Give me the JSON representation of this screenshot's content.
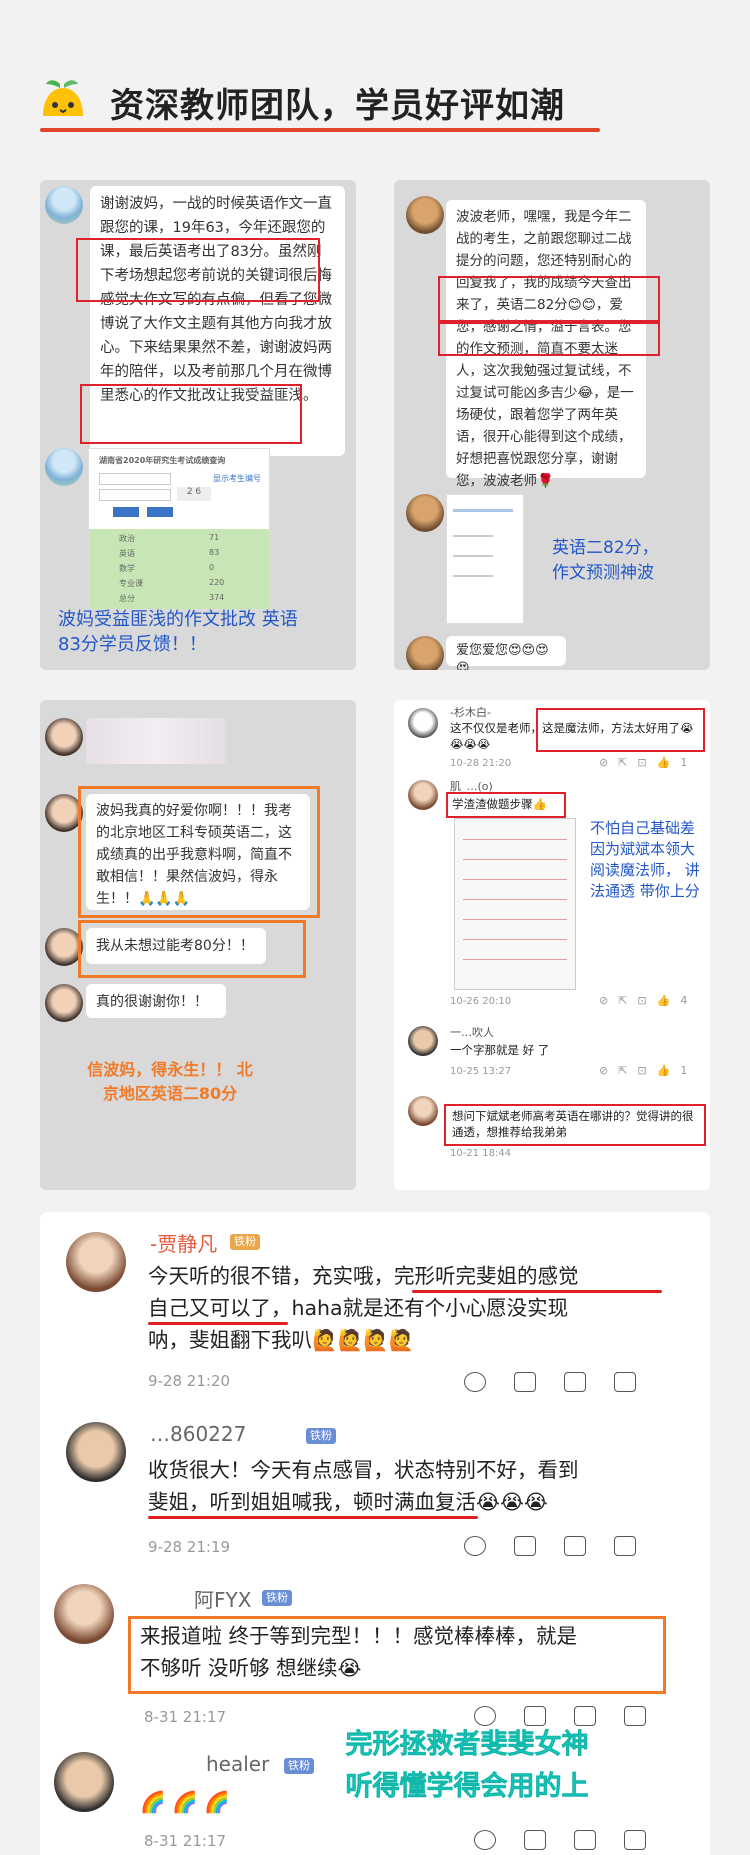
{
  "header": {
    "title": "资深教师团队，学员好评如潮",
    "logo_icon": "orange-mascot-icon",
    "accent": "#e0452a"
  },
  "panel1": {
    "message1": "谢谢波妈，一战的时候英语作文一直跟您的课，19年63，今年还跟您的课，最后英语考出了83分。虽然刚下考场想起您考前说的关键词很后悔感觉大作文写的有点偏，但看了您微博说了大作文主题有其他方向我才放心。下来结果果然不差，谢谢波妈两年的陪伴，以及考前那几个月在微博里悉心的作文批改让我受益匪浅。",
    "score_screenshot_title": "湖南省2020年研究生考试成绩查询",
    "score_link": "显示考生编号",
    "score_rows": [
      {
        "subject": "政治",
        "score": "71"
      },
      {
        "subject": "英语",
        "score": "83"
      },
      {
        "subject": "数学",
        "score": "0"
      },
      {
        "subject": "专业课",
        "score": "220"
      },
      {
        "subject": "总分",
        "score": "374"
      }
    ],
    "caption": "波妈受益匪浅的作文批改 英语83分学员反馈！！"
  },
  "panel2": {
    "message1": "波波老师，嘿嘿，我是今年二战的考生，之前跟您聊过二战提分的问题，您还特别耐心的回复我了，我的成绩今天查出来了，英语二82分😊😊，爱您，感谢之情，溢于言表。您的作文预测，简直不要太迷人，这次我勉强过复试线，不过复试可能凶多吉少😂，是一场硬仗，跟着您学了两年英语，很开心能得到这个成绩，好想把喜悦跟您分享，谢谢您，波波老师🌹",
    "message2": "爱您爱您😍😍😍😍",
    "caption": "英语二82分， 作文预测神波"
  },
  "panel3": {
    "message1": "波妈我真的好爱你啊！！！我考的北京地区工科专硕英语二，这成绩真的出乎我意料啊，简直不敢相信！！果然信波妈，得永生！！🙏🙏🙏",
    "message2": "我从未想过能考80分！！",
    "message3": "真的很谢谢你！！",
    "caption": "信波妈，得永生！！ 北京地区英语二80分"
  },
  "panel4": {
    "c1_name": "-杉木白-",
    "c1_text": "这不仅仅是老师，这是魔法师，方法太好用了😭😭😭😭",
    "c1_time": "10-28 21:20",
    "c1_likes": "1",
    "c2_name": "肌_…(o)",
    "c2_text": "学渣渣做题步骤👍",
    "c2_time": "10-26 20:10",
    "c2_likes": "4",
    "side_note": "不怕自己基础差 因为斌斌本领大 阅读魔法师， 讲法通透 带你上分",
    "c3_name": "一…吹人",
    "c3_text": "一个字那就是 好 了",
    "c3_time": "10-25 13:27",
    "c3_likes": "1",
    "c4_text": "想问下斌斌老师高考英语在哪讲的？觉得讲的很通透，想推荐给我弟弟",
    "c4_time": "10-21 18:44"
  },
  "comments": [
    {
      "name": "-贾静凡",
      "badge": "铁粉",
      "text1": "今天听的很不错，充实哦，完形听完斐姐的感觉",
      "text2": "自己又可以了，haha就是还有个小心愿没实现",
      "text3": "呐，斐姐翻下我叭🙋🙋🙋🙋",
      "time": "9-28 21:20"
    },
    {
      "name": "…860227",
      "badge": "铁粉",
      "text1": "收货很大！今天有点感冒，状态特别不好，看到",
      "text2": "斐姐，听到姐姐喊我，顿时满血复活😭😭😭",
      "time": "9-28 21:19"
    },
    {
      "name": "阿FYX",
      "badge": "铁粉",
      "text1": "来报道啦 终于等到完型！！！感觉棒棒棒，就是",
      "text2": "不够听 没听够 想继续😭",
      "time": "8-31 21:17"
    },
    {
      "name": "healer",
      "badge": "铁粉",
      "text1": "🌈 🌈 🌈",
      "time": "8-31 21:17"
    }
  ],
  "promo_caption_line1": "完形拯救者斐斐女神",
  "promo_caption_line2": "听得懂学得会用的上"
}
